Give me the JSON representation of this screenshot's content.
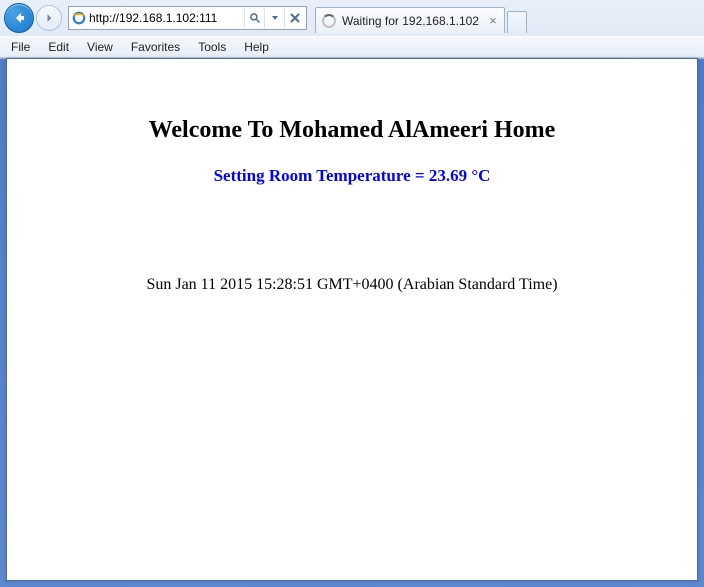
{
  "address": {
    "url": "http://192.168.1.102:111",
    "placeholder": ""
  },
  "tabs": [
    {
      "title": "Waiting for 192.168.1.102"
    }
  ],
  "menus": {
    "file": "File",
    "edit": "Edit",
    "view": "View",
    "favorites": "Favorites",
    "tools": "Tools",
    "help": "Help"
  },
  "page": {
    "heading": "Welcome To Mohamed AlAmeeri Home",
    "subhead_prefix": "Setting Room Temperature = ",
    "temperature": "23.69",
    "subhead_unit": " °C",
    "timestamp": "Sun Jan 11 2015 15:28:51 GMT+0400 (Arabian Standard Time)"
  },
  "icons": {
    "back": "back-arrow",
    "forward": "forward-arrow",
    "ie": "ie-logo",
    "search": "magnifier",
    "refresh": "refresh",
    "stop": "x",
    "dropdown": "chevron-down"
  }
}
